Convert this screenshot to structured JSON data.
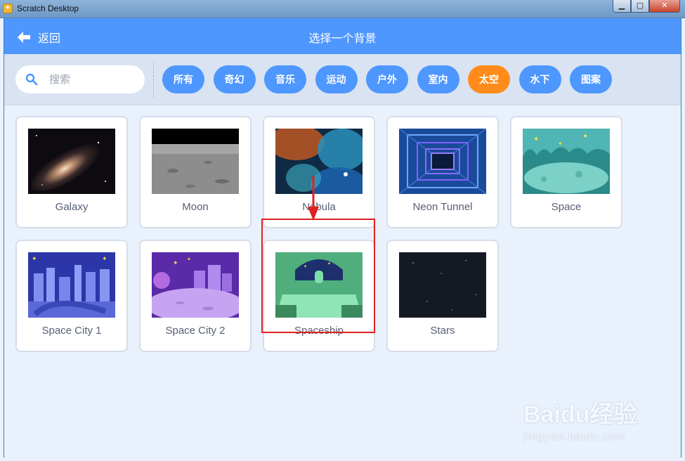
{
  "window": {
    "title": "Scratch Desktop",
    "buttons": [
      "▁",
      "▢",
      "✕"
    ]
  },
  "header": {
    "back_label": "返回",
    "title": "选择一个背景"
  },
  "search": {
    "placeholder": "搜索",
    "value": ""
  },
  "tags": [
    {
      "label": "所有",
      "active": false
    },
    {
      "label": "奇幻",
      "active": false
    },
    {
      "label": "音乐",
      "active": false
    },
    {
      "label": "运动",
      "active": false
    },
    {
      "label": "户外",
      "active": false
    },
    {
      "label": "室内",
      "active": false
    },
    {
      "label": "太空",
      "active": true
    },
    {
      "label": "水下",
      "active": false
    },
    {
      "label": "图案",
      "active": false
    }
  ],
  "backdrops": [
    {
      "name": "Galaxy",
      "thumb": "galaxy-thumbnail",
      "selected": false
    },
    {
      "name": "Moon",
      "thumb": "moon-thumbnail",
      "selected": false
    },
    {
      "name": "Nebula",
      "thumb": "nebula-thumbnail",
      "selected": false
    },
    {
      "name": "Neon Tunnel",
      "thumb": "neon-tunnel-thumbnail",
      "selected": false
    },
    {
      "name": "Space",
      "thumb": "space-thumbnail",
      "selected": false
    },
    {
      "name": "Space City 1",
      "thumb": "space-city-1-thumbnail",
      "selected": false
    },
    {
      "name": "Space City 2",
      "thumb": "space-city-2-thumbnail",
      "selected": false
    },
    {
      "name": "Spaceship",
      "thumb": "spaceship-thumbnail",
      "selected": true
    },
    {
      "name": "Stars",
      "thumb": "stars-thumbnail",
      "selected": false
    }
  ],
  "colors": {
    "header": "#4d97ff",
    "active_tag": "#ff8c1a",
    "tag": "#4d97ff",
    "annotation": "#e02020"
  },
  "watermark": {
    "brand": "Baidu经验",
    "site": "jingyan.baidu.com"
  }
}
